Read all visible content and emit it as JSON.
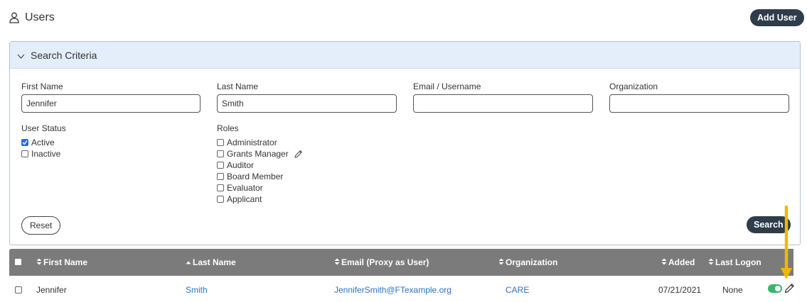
{
  "header": {
    "title": "Users",
    "add_user_label": "Add User"
  },
  "search": {
    "panel_title": "Search Criteria",
    "fields": {
      "first_name": {
        "label": "First Name",
        "value": "Jennifer"
      },
      "last_name": {
        "label": "Last Name",
        "value": "Smith"
      },
      "email": {
        "label": "Email / Username",
        "value": ""
      },
      "organization": {
        "label": "Organization",
        "value": ""
      }
    },
    "user_status": {
      "label": "User Status",
      "options": [
        {
          "label": "Active",
          "checked": true
        },
        {
          "label": "Inactive",
          "checked": false
        }
      ]
    },
    "roles": {
      "label": "Roles",
      "options": [
        {
          "label": "Administrator",
          "checked": false
        },
        {
          "label": "Grants Manager",
          "checked": false
        },
        {
          "label": "Auditor",
          "checked": false
        },
        {
          "label": "Board Member",
          "checked": false
        },
        {
          "label": "Evaluator",
          "checked": false
        },
        {
          "label": "Applicant",
          "checked": false
        }
      ]
    },
    "reset_label": "Reset",
    "search_label": "Search"
  },
  "table": {
    "columns": [
      {
        "label": "First Name",
        "sort": "both"
      },
      {
        "label": "Last Name",
        "sort": "asc"
      },
      {
        "label": "Email (Proxy as User)",
        "sort": "both"
      },
      {
        "label": "Organization",
        "sort": "both"
      },
      {
        "label": "Added",
        "sort": "both"
      },
      {
        "label": "Last Logon",
        "sort": "both"
      }
    ],
    "rows": [
      {
        "first_name": "Jennifer",
        "last_name": "Smith",
        "email": "JenniferSmith@FTexample.org",
        "organization": "CARE",
        "added": "07/21/2021",
        "last_logon": "None",
        "active": true
      }
    ]
  },
  "colors": {
    "dark_button": "#2f3c4a",
    "panel_header": "#e3eefa",
    "table_header": "#7b7b7b",
    "link": "#2a72c9",
    "toggle_on": "#3bb56c",
    "annotation_arrow": "#f2b705"
  }
}
